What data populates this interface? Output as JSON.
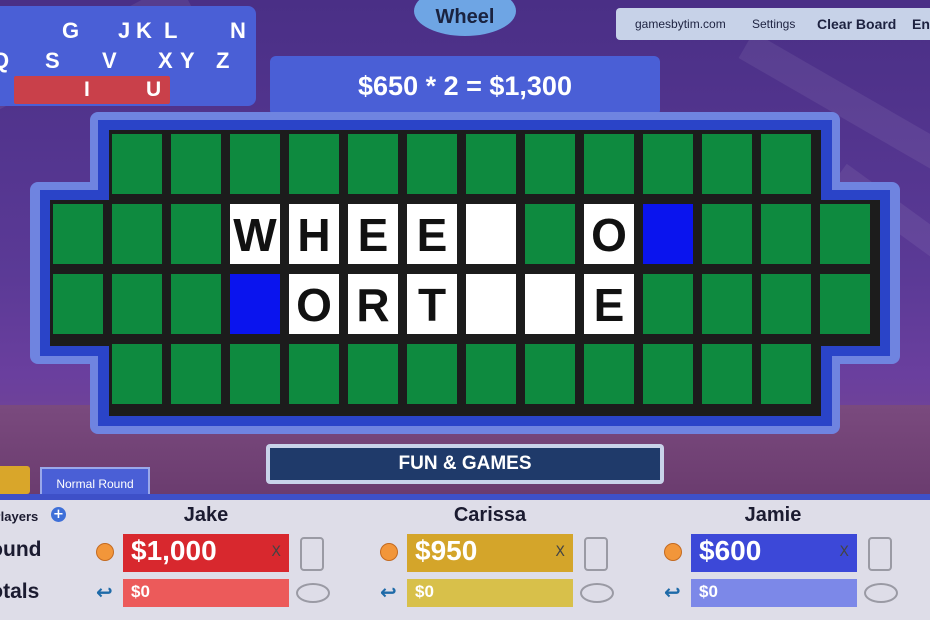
{
  "used_letters": {
    "row1": [
      "G",
      "J",
      "K",
      "L",
      "N"
    ],
    "row2": [
      "Q",
      "S",
      "V",
      "X",
      "Y",
      "Z"
    ],
    "called": [
      "I",
      "U"
    ]
  },
  "wheel_button": "Wheel",
  "nav": {
    "site": "gamesbytim.com",
    "settings": "Settings",
    "clear_board": "Clear Board",
    "end": "En"
  },
  "score_banner": "$650 * 2 = $1,300",
  "board": {
    "rows": [
      [
        "",
        "G",
        "G",
        "G",
        "G",
        "G",
        "G",
        "G",
        "G",
        "G",
        "G",
        "G",
        "G",
        ""
      ],
      [
        "G",
        "G",
        "G",
        "W",
        "H",
        "E",
        "E",
        "_",
        "G",
        "O",
        "B",
        "G",
        "G",
        "G"
      ],
      [
        "G",
        "G",
        "G",
        "B",
        "O",
        "R",
        "T",
        "_",
        "_",
        "E",
        "G",
        "G",
        "G",
        "G"
      ],
      [
        "",
        "G",
        "G",
        "G",
        "G",
        "G",
        "G",
        "G",
        "G",
        "G",
        "G",
        "G",
        "G",
        ""
      ]
    ],
    "legend": {
      "G": "green-unused",
      "B": "blue-highlight",
      "_": "white-hidden-letter"
    }
  },
  "category": "FUN & GAMES",
  "round_tab": "Normal Round",
  "players_panel": {
    "players_label": "Players",
    "add_symbol": "+",
    "round_label": "Round",
    "totals_label": "Totals",
    "players": [
      {
        "name": "Jake",
        "round": "$1,000",
        "total": "$0",
        "color": "#d8282e",
        "total_color": "#ec5a5a"
      },
      {
        "name": "Carissa",
        "round": "$950",
        "total": "$0",
        "color": "#d4a52a",
        "total_color": "#d8c04a"
      },
      {
        "name": "Jamie",
        "round": "$600",
        "total": "$0",
        "color": "#3c48d8",
        "total_color": "#7c88e8"
      }
    ],
    "clear_symbol": "X"
  }
}
